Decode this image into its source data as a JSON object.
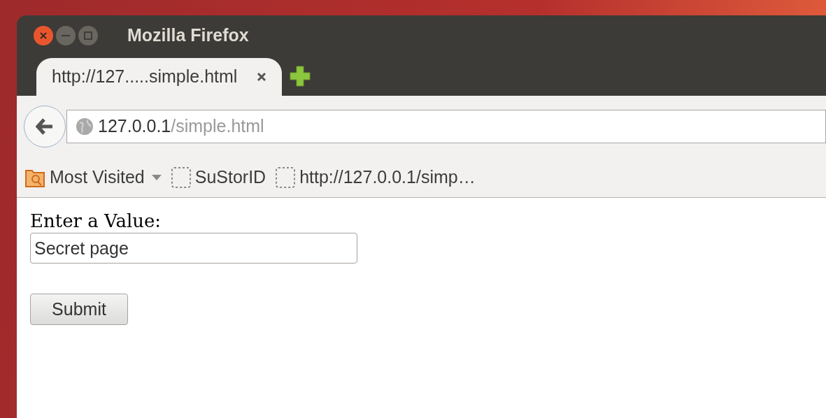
{
  "window": {
    "title": "Mozilla Firefox"
  },
  "tabs": [
    {
      "label": "http://127.....simple.html",
      "selected": true
    }
  ],
  "address_bar": {
    "host": "127.0.0.1",
    "path": "/simple.html"
  },
  "bookmarks": [
    {
      "kind": "folder",
      "label": "Most Visited"
    },
    {
      "kind": "bookmark",
      "label": "SuStorID"
    },
    {
      "kind": "bookmark",
      "label": "http://127.0.0.1/simp…"
    }
  ],
  "form": {
    "label": "Enter a Value:",
    "value": "Secret page",
    "submit": "Submit"
  }
}
